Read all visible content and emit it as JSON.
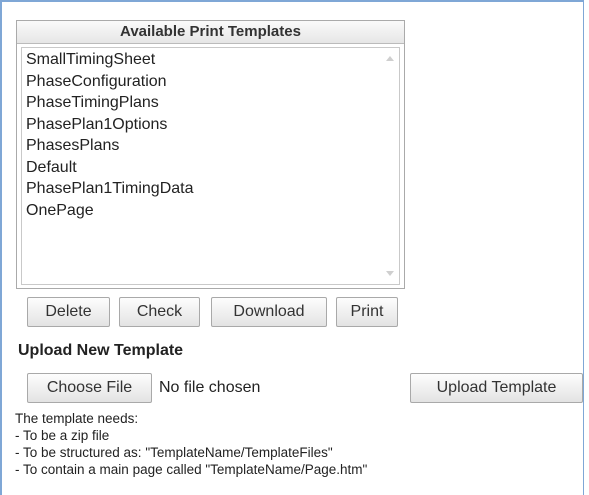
{
  "templates_panel": {
    "header": "Available Print Templates",
    "items": [
      "SmallTimingSheet",
      "PhaseConfiguration",
      "PhaseTimingPlans",
      "PhasePlan1Options",
      "PhasesPlans",
      "Default",
      "PhasePlan1TimingData",
      "OnePage"
    ]
  },
  "actions": {
    "delete_label": "Delete",
    "check_label": "Check",
    "download_label": "Download",
    "print_label": "Print"
  },
  "upload": {
    "title": "Upload New Template",
    "choose_file_label": "Choose File",
    "file_status": "No file chosen",
    "upload_label": "Upload Template"
  },
  "notes": {
    "intro": "The template needs:",
    "line1": "- To be a zip file",
    "line2": "- To be structured as: \"TemplateName/TemplateFiles\"",
    "line3": "- To contain a main page called \"TemplateName/Page.htm\""
  },
  "colors": {
    "frame_border": "#7fa7d6"
  }
}
